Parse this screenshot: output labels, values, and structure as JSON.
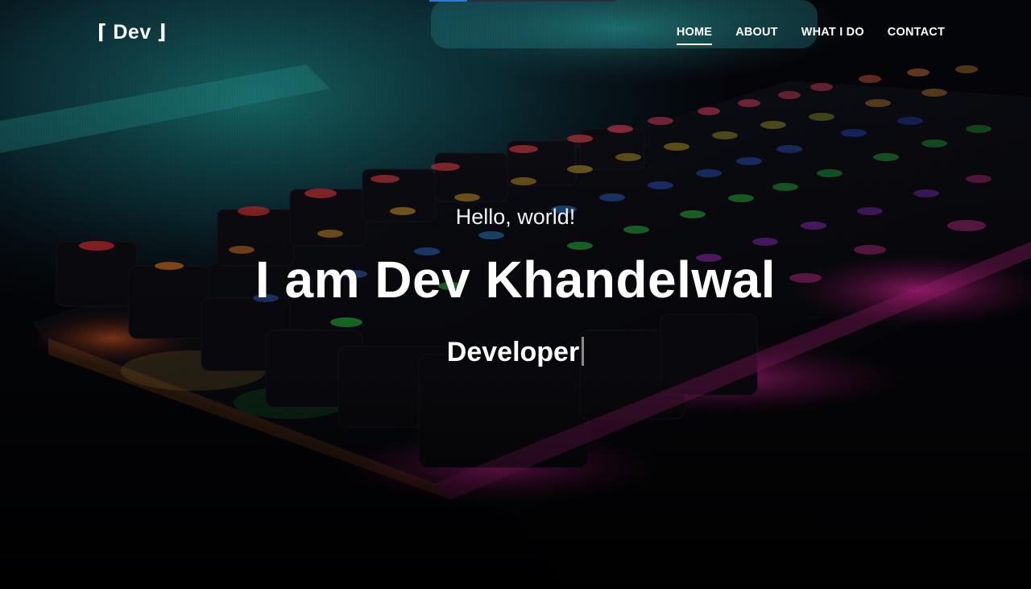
{
  "brand": {
    "text": "⌈ Dev ⌋"
  },
  "nav": {
    "items": [
      {
        "label": "HOME",
        "active": true
      },
      {
        "label": "ABOUT",
        "active": false
      },
      {
        "label": "WHAT I DO",
        "active": false
      },
      {
        "label": "CONTACT",
        "active": false
      }
    ]
  },
  "hero": {
    "greeting": "Hello, world!",
    "headline": "I am Dev Khandelwal",
    "role": "Developer",
    "background": "rgb-keyboard-photo"
  },
  "colors": {
    "text": "#ffffff",
    "accent_blue": "#2f7bd6",
    "cursor": "#8a8a8a"
  }
}
